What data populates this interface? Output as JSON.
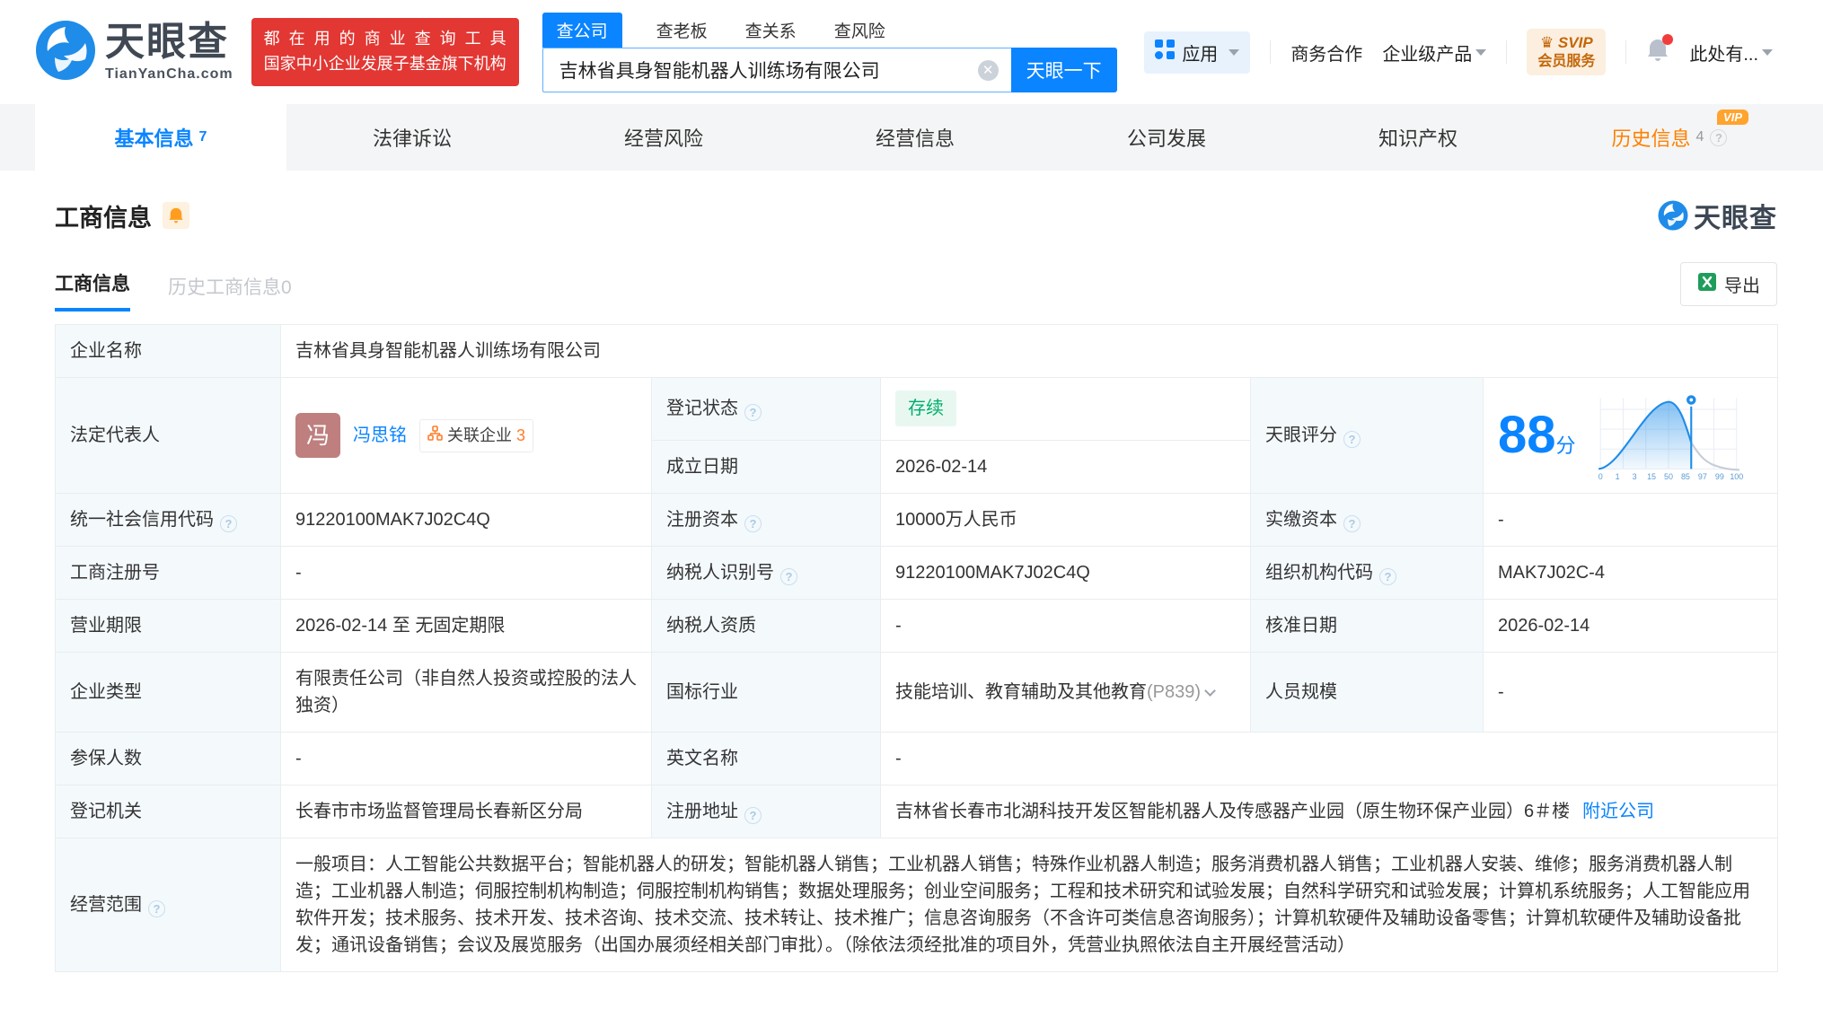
{
  "brand": {
    "name": "天眼查",
    "domain": "TianYanCha.com",
    "slogan1": "都在用的商业查询工具",
    "slogan2": "国家中小企业发展子基金旗下机构"
  },
  "search": {
    "tabs": [
      "查公司",
      "查老板",
      "查关系",
      "查风险"
    ],
    "value": "吉林省具身智能机器人训练场有限公司",
    "button": "天眼一下"
  },
  "topnav": {
    "apps": "应用",
    "cooperation": "商务合作",
    "enterprise": "企业级产品",
    "svip_top": "SVIP",
    "svip_bottom": "会员服务",
    "account": "此处有..."
  },
  "tabs": {
    "t0": {
      "label": "基本信息",
      "count": "7"
    },
    "t1": {
      "label": "法律诉讼"
    },
    "t2": {
      "label": "经营风险"
    },
    "t3": {
      "label": "经营信息"
    },
    "t4": {
      "label": "公司发展"
    },
    "t5": {
      "label": "知识产权"
    },
    "t6": {
      "label": "历史信息",
      "count": "4",
      "vip": "VIP"
    }
  },
  "section": {
    "title": "工商信息",
    "subtab_active": "工商信息",
    "subtab_history": "历史工商信息0",
    "export": "导出",
    "watermark": "天眼查"
  },
  "score": {
    "value": "88",
    "unit": "分",
    "axis": [
      "0",
      "1",
      "3",
      "15",
      "50",
      "85",
      "97",
      "99",
      "100"
    ]
  },
  "fields": {
    "company_name": {
      "label": "企业名称",
      "value": "吉林省具身智能机器人训练场有限公司"
    },
    "legal_rep": {
      "label": "法定代表人",
      "avatar": "冯",
      "name": "冯思铭",
      "related_label": "关联企业",
      "related_count": "3"
    },
    "reg_status": {
      "label": "登记状态",
      "value": "存续"
    },
    "est_date": {
      "label": "成立日期",
      "value": "2026-02-14"
    },
    "tyc_score": {
      "label": "天眼评分"
    },
    "credit_code": {
      "label": "统一社会信用代码",
      "value": "91220100MAK7J02C4Q"
    },
    "reg_capital": {
      "label": "注册资本",
      "value": "10000万人民币"
    },
    "paid_capital": {
      "label": "实缴资本",
      "value": "-"
    },
    "reg_number": {
      "label": "工商注册号",
      "value": "-"
    },
    "taxpayer_id": {
      "label": "纳税人识别号",
      "value": "91220100MAK7J02C4Q"
    },
    "org_code": {
      "label": "组织机构代码",
      "value": "MAK7J02C-4"
    },
    "business_term": {
      "label": "营业期限",
      "value": "2026-02-14 至 无固定期限"
    },
    "taxpayer_qualification": {
      "label": "纳税人资质",
      "value": "-"
    },
    "approval_date": {
      "label": "核准日期",
      "value": "2026-02-14"
    },
    "company_type": {
      "label": "企业类型",
      "value": "有限责任公司（非自然人投资或控股的法人独资）"
    },
    "industry": {
      "label": "国标行业",
      "value": "技能培训、教育辅助及其他教育",
      "code": "(P839)"
    },
    "staff_size": {
      "label": "人员规模",
      "value": "-"
    },
    "insured_count": {
      "label": "参保人数",
      "value": "-"
    },
    "english_name": {
      "label": "英文名称",
      "value": "-"
    },
    "reg_authority": {
      "label": "登记机关",
      "value": "长春市市场监督管理局长春新区分局"
    },
    "reg_address": {
      "label": "注册地址",
      "value": "吉林省长春市北湖科技开发区智能机器人及传感器产业园（原生物环保产业园）6＃楼",
      "nearby": "附近公司"
    },
    "business_scope": {
      "label": "经营范围",
      "value": "一般项目：人工智能公共数据平台；智能机器人的研发；智能机器人销售；工业机器人销售；特殊作业机器人制造；服务消费机器人销售；工业机器人安装、维修；服务消费机器人制造；工业机器人制造；伺服控制机构制造；伺服控制机构销售；数据处理服务；创业空间服务；工程和技术研究和试验发展；自然科学研究和试验发展；计算机系统服务；人工智能应用软件开发；技术服务、技术开发、技术咨询、技术交流、技术转让、技术推广；信息咨询服务（不含许可类信息咨询服务）；计算机软硬件及辅助设备零售；计算机软硬件及辅助设备批发；通讯设备销售；会议及展览服务（出国办展须经相关部门审批）。（除依法须经批准的项目外，凭营业执照依法自主开展经营活动）"
    }
  }
}
